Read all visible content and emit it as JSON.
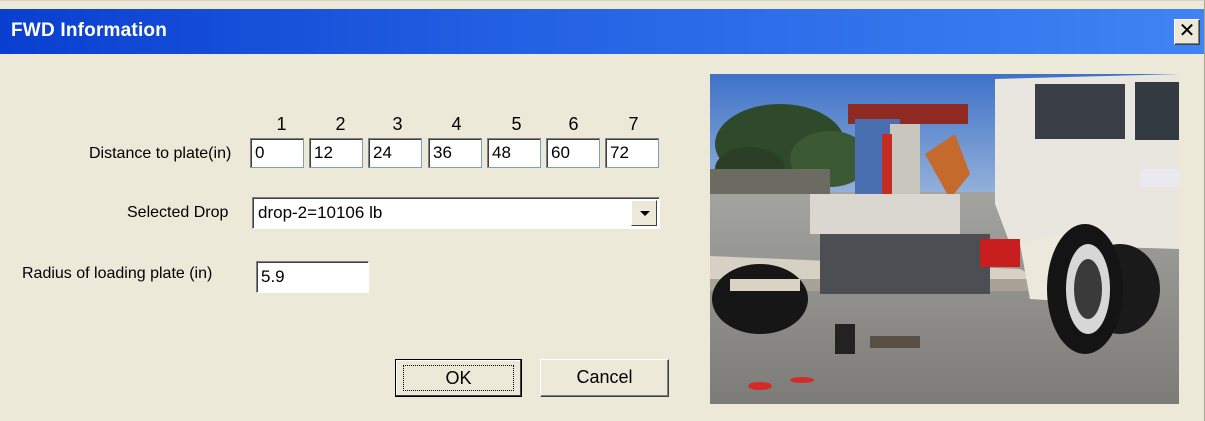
{
  "window": {
    "title": "FWD Information",
    "close_label": "✕"
  },
  "distance": {
    "label": "Distance to plate(in)",
    "column_headers": [
      "1",
      "2",
      "3",
      "4",
      "5",
      "6",
      "7"
    ],
    "values": [
      "0",
      "12",
      "24",
      "36",
      "48",
      "60",
      "72"
    ]
  },
  "drop": {
    "label": "Selected Drop",
    "selected": "drop-2=10106 lb"
  },
  "radius": {
    "label": "Radius of loading plate (in)",
    "value": "5.9"
  },
  "buttons": {
    "ok": "OK",
    "cancel": "Cancel"
  },
  "photo": {
    "icon": "fwd-trailer-photo"
  }
}
